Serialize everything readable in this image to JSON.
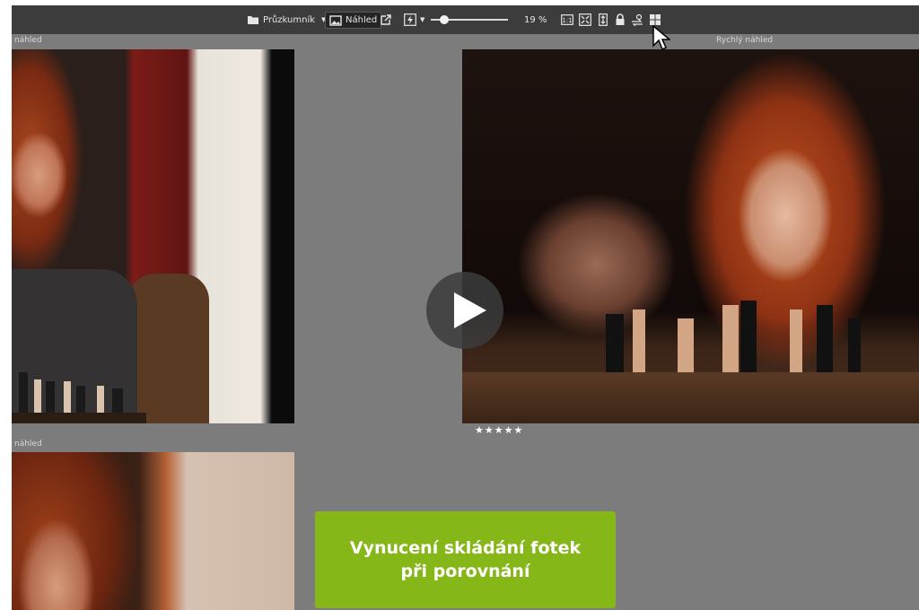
{
  "toolbar": {
    "explorer_label": "Průzkumník",
    "preview_label": "Náhled",
    "zoom_value": "19 %",
    "zoom_fraction": 0.19,
    "one_to_one_label": "1:1"
  },
  "panels": {
    "left_caption": "náhled",
    "right_caption": "Rychlý náhled",
    "bottom_caption": "náhled"
  },
  "rating": {
    "stars": "★★★★★",
    "value": 5,
    "max": 5
  },
  "cta": {
    "line1": "Vynucení skládání fotek",
    "line2": "při porovnání"
  },
  "icons": [
    "folder-icon",
    "image-icon",
    "external-link-icon",
    "flash-icon",
    "one-to-one-icon",
    "fit-icon",
    "fill-icon",
    "lock-icon",
    "swap-icon",
    "grid-icon",
    "play-icon",
    "mouse-cursor-icon"
  ],
  "colors": {
    "toolbar_bg": "#3c3c3c",
    "workspace_bg": "#7c7c7c",
    "cta_bg": "#86b719"
  }
}
